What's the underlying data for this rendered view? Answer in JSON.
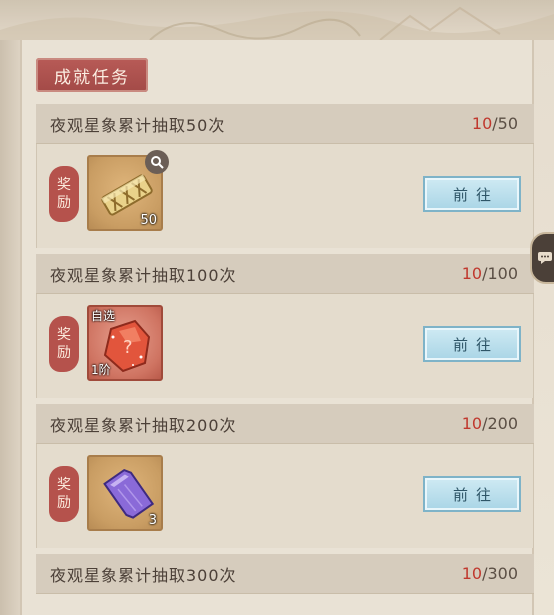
{
  "section": {
    "title": "成就任务"
  },
  "tasks": [
    {
      "title": "夜观星象累计抽取50次",
      "current": "10",
      "total": "/50",
      "reward_label_top": "奖",
      "reward_label_bottom": "励",
      "item": {
        "icon": "golden-rune-block-icon",
        "count": "50",
        "tag": "",
        "grade": ""
      },
      "button": "前往"
    },
    {
      "title": "夜观星象累计抽取100次",
      "current": "10",
      "total": "/100",
      "reward_label_top": "奖",
      "reward_label_bottom": "励",
      "item": {
        "icon": "red-crystal-mystery-icon",
        "count": "",
        "tag": "自选",
        "grade": "1阶"
      },
      "button": "前往"
    },
    {
      "title": "夜观星象累计抽取200次",
      "current": "10",
      "total": "/200",
      "reward_label_top": "奖",
      "reward_label_bottom": "励",
      "item": {
        "icon": "purple-crystal-icon",
        "count": "3",
        "tag": "",
        "grade": ""
      },
      "button": "前往"
    },
    {
      "title": "夜观星象累计抽取300次",
      "current": "10",
      "total": "/300"
    }
  ],
  "colors": {
    "accent_red": "#c0382e",
    "title_banner": "#a34a47",
    "button_blue": "#a9d5e6"
  }
}
